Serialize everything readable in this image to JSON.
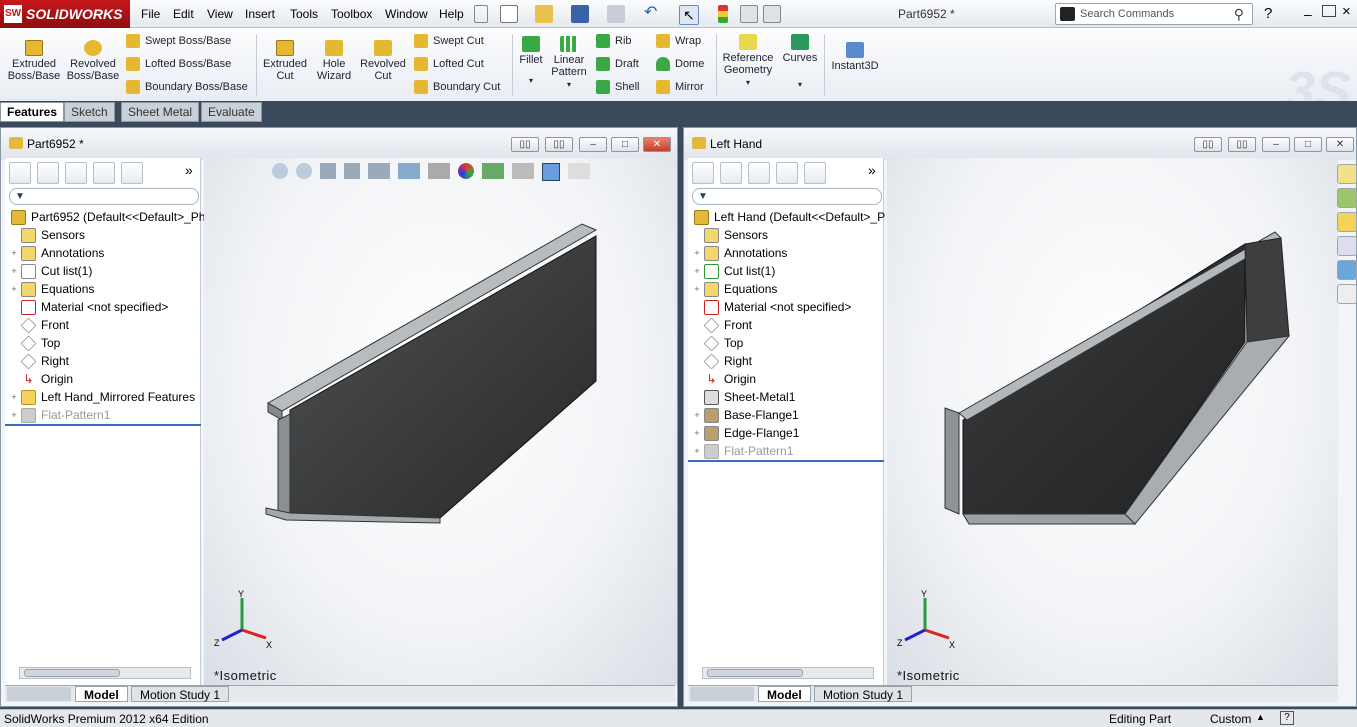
{
  "app": {
    "name": "SOLIDWORKS",
    "doc_title": "Part6952 *"
  },
  "menu": [
    "File",
    "Edit",
    "View",
    "Insert",
    "Tools",
    "Toolbox",
    "Window",
    "Help"
  ],
  "search": {
    "placeholder": "Search Commands"
  },
  "ribbon": {
    "extruded_boss": "Extruded Boss/Base",
    "revolved_boss": "Revolved Boss/Base",
    "swept_boss": "Swept Boss/Base",
    "lofted_boss": "Lofted Boss/Base",
    "boundary_boss": "Boundary Boss/Base",
    "extruded_cut": "Extruded Cut",
    "hole_wizard": "Hole Wizard",
    "revolved_cut": "Revolved Cut",
    "swept_cut": "Swept Cut",
    "lofted_cut": "Lofted Cut",
    "boundary_cut": "Boundary Cut",
    "fillet": "Fillet",
    "linear_pattern": "Linear Pattern",
    "rib": "Rib",
    "draft": "Draft",
    "shell": "Shell",
    "wrap": "Wrap",
    "dome": "Dome",
    "mirror": "Mirror",
    "reference_geometry": "Reference Geometry",
    "curves": "Curves",
    "instant3d": "Instant3D"
  },
  "command_tabs": [
    "Features",
    "Sketch",
    "Sheet Metal",
    "Evaluate"
  ],
  "left_pane": {
    "title": "Part6952 *",
    "tree": [
      {
        "label": "Part6952  (Default<<Default>_Ph",
        "expand": "",
        "dim": false
      },
      {
        "label": "Sensors",
        "expand": "",
        "dim": false
      },
      {
        "label": "Annotations",
        "expand": "+",
        "dim": false
      },
      {
        "label": "Cut list(1)",
        "expand": "+",
        "dim": false
      },
      {
        "label": "Equations",
        "expand": "+",
        "dim": false
      },
      {
        "label": "Material <not specified>",
        "expand": "",
        "dim": false
      },
      {
        "label": "Front",
        "expand": "",
        "dim": false
      },
      {
        "label": "Top",
        "expand": "",
        "dim": false
      },
      {
        "label": "Right",
        "expand": "",
        "dim": false
      },
      {
        "label": "Origin",
        "expand": "",
        "dim": false
      },
      {
        "label": "Left Hand_Mirrored Features",
        "expand": "+",
        "dim": false
      },
      {
        "label": "Flat-Pattern1",
        "expand": "+",
        "dim": true
      }
    ],
    "view_label": "*Isometric",
    "tabs": [
      "Model",
      "Motion Study 1"
    ]
  },
  "right_pane": {
    "title": "Left Hand",
    "tree": [
      {
        "label": "Left Hand  (Default<<Default>_P",
        "expand": "",
        "dim": false
      },
      {
        "label": "Sensors",
        "expand": "",
        "dim": false
      },
      {
        "label": "Annotations",
        "expand": "+",
        "dim": false
      },
      {
        "label": "Cut list(1)",
        "expand": "+",
        "dim": false
      },
      {
        "label": "Equations",
        "expand": "+",
        "dim": false
      },
      {
        "label": "Material <not specified>",
        "expand": "",
        "dim": false
      },
      {
        "label": "Front",
        "expand": "",
        "dim": false
      },
      {
        "label": "Top",
        "expand": "",
        "dim": false
      },
      {
        "label": "Right",
        "expand": "",
        "dim": false
      },
      {
        "label": "Origin",
        "expand": "",
        "dim": false
      },
      {
        "label": "Sheet-Metal1",
        "expand": "",
        "dim": false
      },
      {
        "label": "Base-Flange1",
        "expand": "+",
        "dim": false
      },
      {
        "label": "Edge-Flange1",
        "expand": "+",
        "dim": false
      },
      {
        "label": "Flat-Pattern1",
        "expand": "+",
        "dim": true
      }
    ],
    "view_label": "*Isometric",
    "tabs": [
      "Model",
      "Motion Study 1"
    ]
  },
  "status": {
    "edition": "SolidWorks Premium 2012 x64 Edition",
    "mode": "Editing Part",
    "units": "Custom"
  }
}
